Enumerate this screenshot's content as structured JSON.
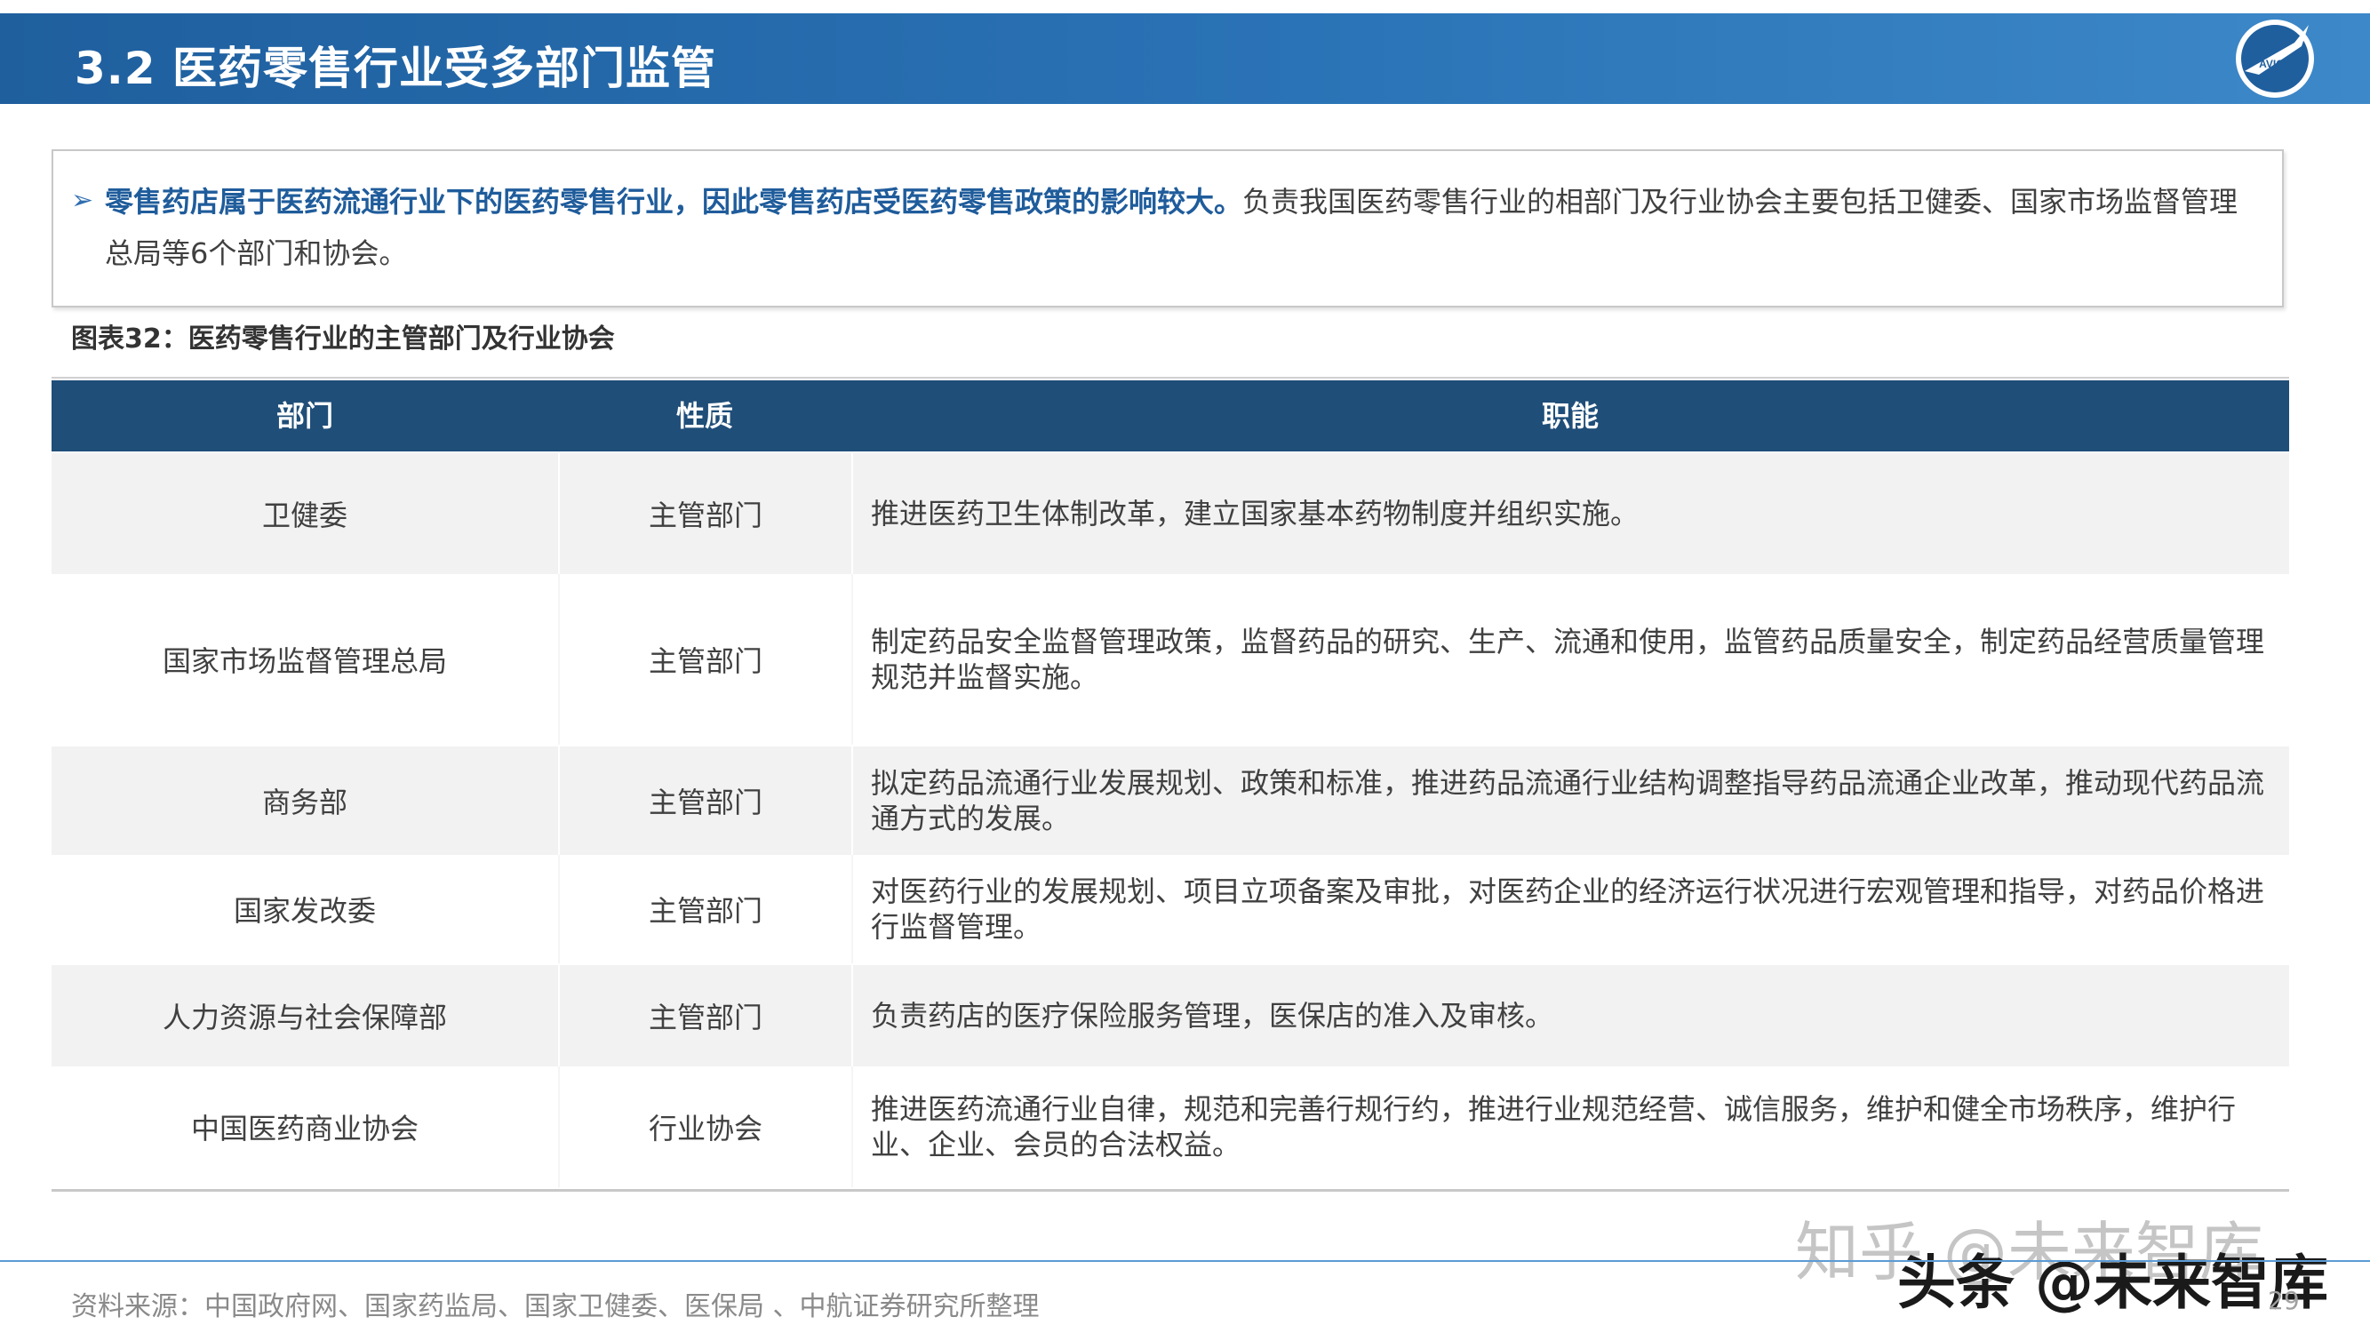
{
  "header": {
    "title": "3.2 医药零售行业受多部门监管"
  },
  "intro": {
    "highlight": "零售药店属于医药流通行业下的医药零售行业，因此零售药店受医药零售政策的影响较大。",
    "rest": "负责我国医药零售行业的相部门及行业协会主要包括卫健委、国家市场监督管理总局等6个部门和协会。"
  },
  "caption": "图表32：医药零售行业的主管部门及行业协会",
  "table": {
    "headers": [
      "部门",
      "性质",
      "职能"
    ],
    "rows": [
      {
        "dept": "卫健委",
        "type": "主管部门",
        "duty": "推进医药卫生体制改革，建立国家基本药物制度并组织实施。"
      },
      {
        "dept": "国家市场监督管理总局",
        "type": "主管部门",
        "duty": "制定药品安全监督管理政策，监督药品的研究、生产、流通和使用，监管药品质量安全，制定药品经营质量管理规范并监督实施。"
      },
      {
        "dept": "商务部",
        "type": "主管部门",
        "duty": "拟定药品流通行业发展规划、政策和标准，推进药品流通行业结构调整指导药品流通企业改革，推动现代药品流通方式的发展。"
      },
      {
        "dept": "国家发改委",
        "type": "主管部门",
        "duty": "对医药行业的发展规划、项目立项备案及审批，对医药企业的经济运行状况进行宏观管理和指导，对药品价格进行监督管理。"
      },
      {
        "dept": "人力资源与社会保障部",
        "type": "主管部门",
        "duty": "负责药店的医疗保险服务管理，医保店的准入及审核。"
      },
      {
        "dept": "中国医药商业协会",
        "type": "行业协会",
        "duty": "推进医药流通行业自律，规范和完善行规行约，推进行业规范经营、诚信服务，维护和健全市场秩序，维护行业、企业、会员的合法权益。"
      }
    ]
  },
  "footer": {
    "source": "资料来源：中国政府网、国家药监局、国家卫健委、医保局 、中航证券研究所整理",
    "page": "29"
  },
  "logo_text": "AVIC",
  "watermark": {
    "line1": "知乎 @未来智库",
    "line2": "头条 @未来智库"
  }
}
